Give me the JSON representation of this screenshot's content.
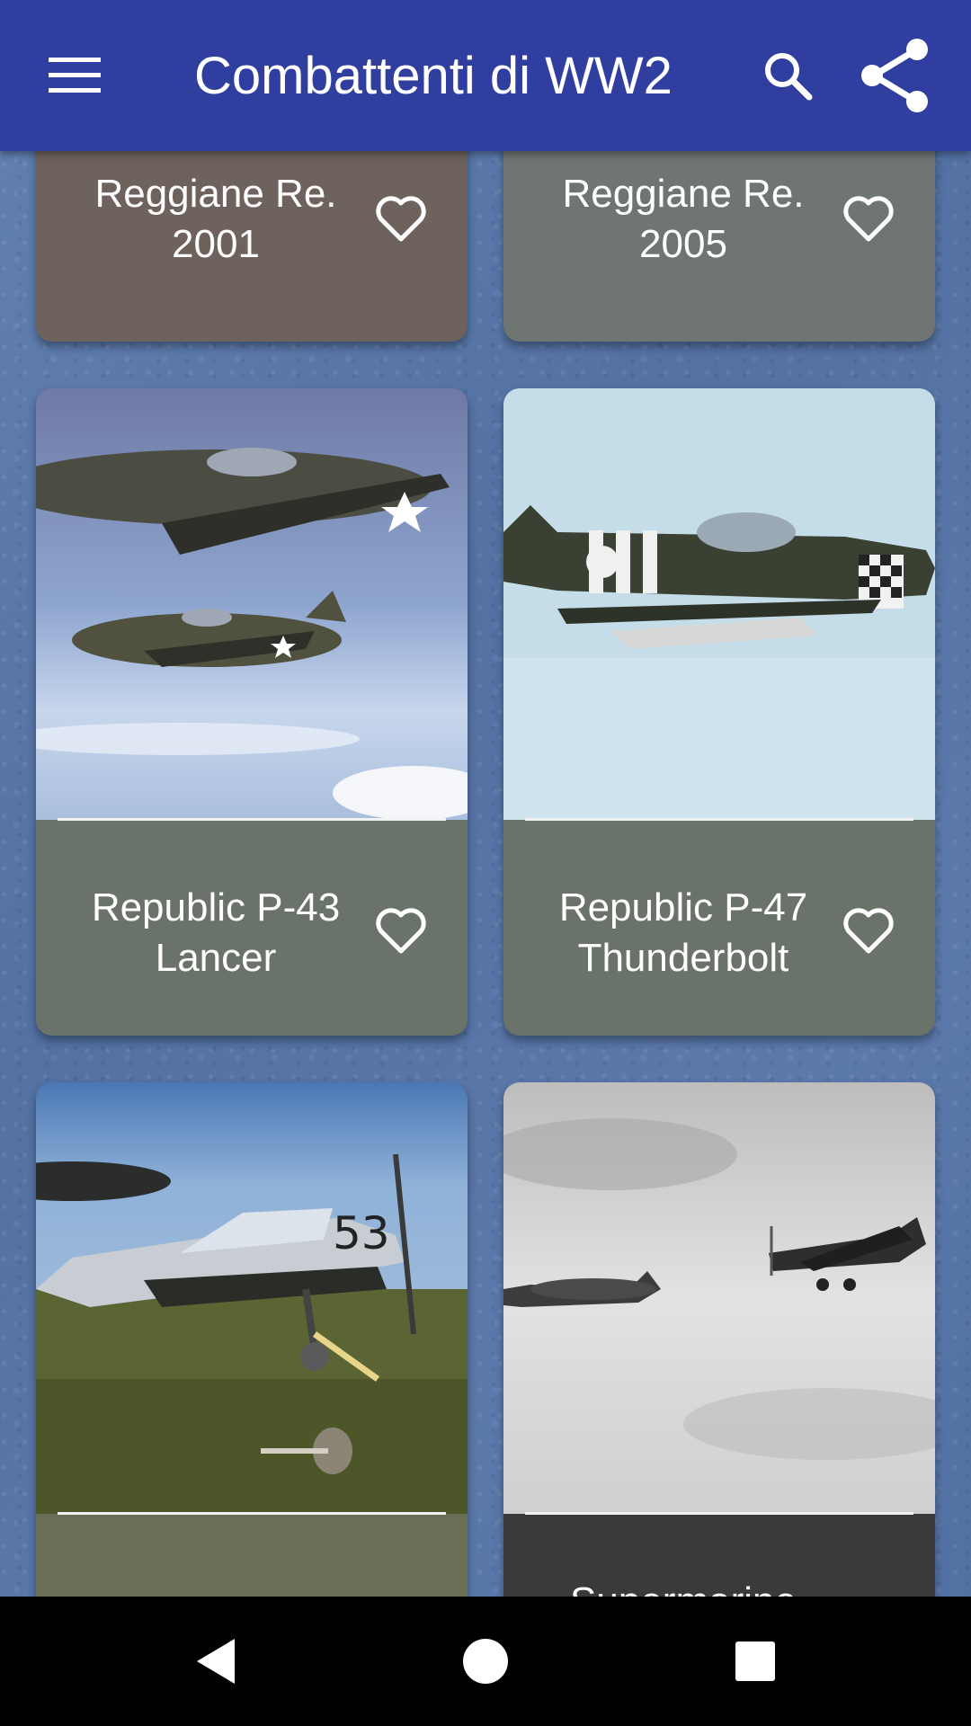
{
  "app": {
    "title": "Combattenti di WW2",
    "colors": {
      "appbar": "#303f9f",
      "background": "#5a78aa"
    }
  },
  "toolbar": {
    "menu_icon": "hamburger-menu-icon",
    "search_icon": "search-icon",
    "share_icon": "share-icon"
  },
  "cards": [
    {
      "name": "Reggiane Re. 2001",
      "line1": "Reggiane Re.",
      "line2": "2001",
      "label_bg": "#6d625c",
      "favorite": false
    },
    {
      "name": "Reggiane Re. 2005",
      "line1": "Reggiane Re.",
      "line2": "2005",
      "label_bg": "#6f7672",
      "favorite": false
    },
    {
      "name": "Republic P-43 Lancer",
      "line1": "Republic P-43",
      "line2": "Lancer",
      "label_bg": "#69736a",
      "favorite": false
    },
    {
      "name": "Republic P-47 Thunderbolt",
      "line1": "Republic P-47",
      "line2": "Thunderbolt",
      "label_bg": "#69736a",
      "favorite": false
    },
    {
      "name": "",
      "line1": "",
      "line2": "",
      "label_bg": "#6c6d55",
      "favorite": false
    },
    {
      "name": "Supermarine",
      "line1": "Supermarine",
      "line2": "",
      "label_bg": "#3a3a3a",
      "favorite": false
    }
  ],
  "navbar": {
    "back_icon": "back-triangle-icon",
    "home_icon": "home-circle-icon",
    "recents_icon": "recents-square-icon"
  }
}
